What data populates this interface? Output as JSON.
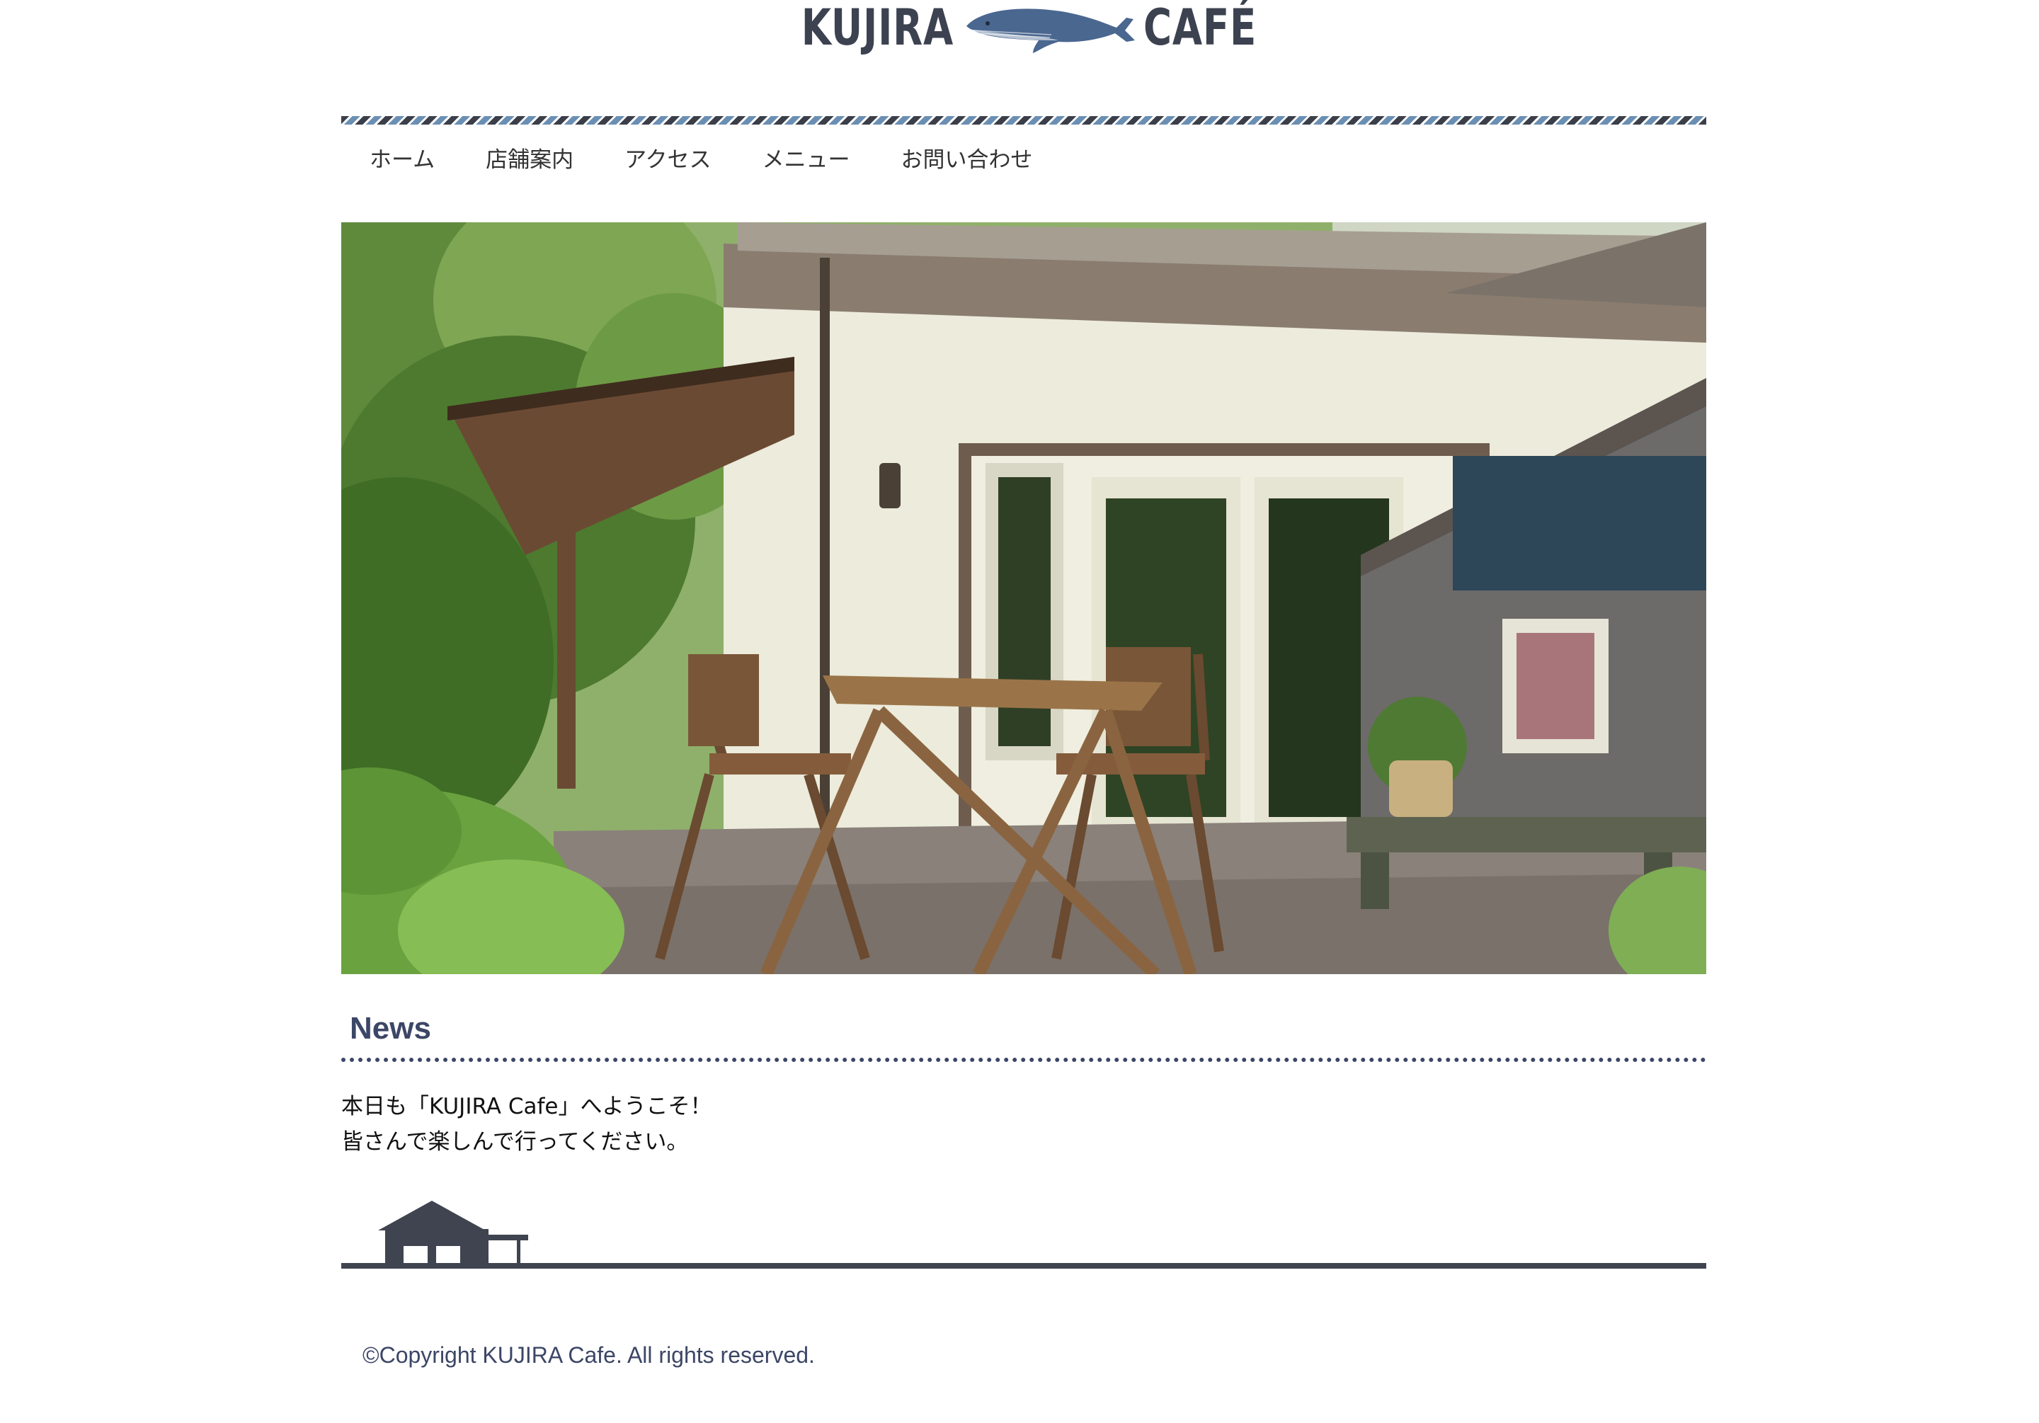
{
  "header": {
    "logo_left": "KUJIRA",
    "logo_right": "CAFÉ",
    "logo_icon": "whale-icon"
  },
  "nav": {
    "items": [
      {
        "label": "ホーム"
      },
      {
        "label": "店舗案内"
      },
      {
        "label": "アクセス"
      },
      {
        "label": "メニュー"
      },
      {
        "label": "お問い合わせ"
      }
    ]
  },
  "hero": {
    "image": "cafe-terrace-photo"
  },
  "news": {
    "title": "News",
    "line1": "本日も「KUJIRA Cafe」へようこそ！",
    "line2": "皆さんで楽しんで行ってください。"
  },
  "footer": {
    "icon": "house-icon",
    "copyright": "©Copyright KUJIRA Cafe. All rights reserved."
  },
  "colors": {
    "brand": "#3c4666",
    "stripe_dark": "#3b3f4a",
    "stripe_blue": "#6b8fb3",
    "footer_line": "#3f4450"
  }
}
